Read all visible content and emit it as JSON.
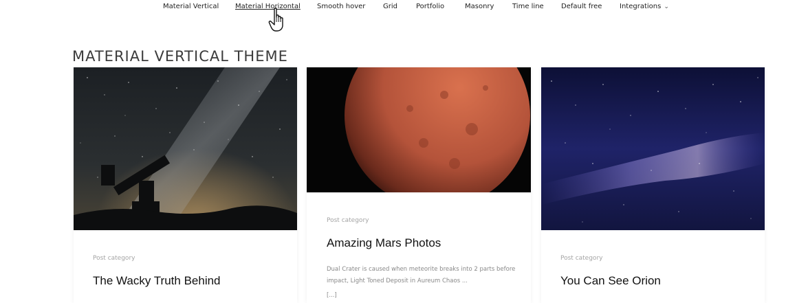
{
  "nav": {
    "items": [
      {
        "label": "Material Vertical"
      },
      {
        "label": "Material Horizontal"
      },
      {
        "label": "Smooth hover"
      },
      {
        "label": "Grid"
      },
      {
        "label": "Portfolio"
      },
      {
        "label": "Masonry"
      },
      {
        "label": "Time line"
      },
      {
        "label": "Default free"
      },
      {
        "label": "Integrations"
      }
    ],
    "active_index": 1
  },
  "page": {
    "title": "MATERIAL VERTICAL THEME"
  },
  "cards": [
    {
      "image_icon": "telescope-milky-way-photo",
      "category": "Post category",
      "title": "The Wacky Truth Behind"
    },
    {
      "image_icon": "mars-planet-photo",
      "category": "Post category",
      "title": "Amazing Mars Photos",
      "excerpt": "Dual Crater is caused when meteorite breaks into 2 parts before impact, Light Toned Deposit in Aureum Chaos ...",
      "more": "[...]"
    },
    {
      "image_icon": "orion-starfield-photo",
      "category": "Post category",
      "title": "You Can See Orion"
    }
  ],
  "colors": {
    "accent_text": "#222222",
    "category_gray": "#a4a4a4",
    "excerpt_gray": "#888888"
  }
}
